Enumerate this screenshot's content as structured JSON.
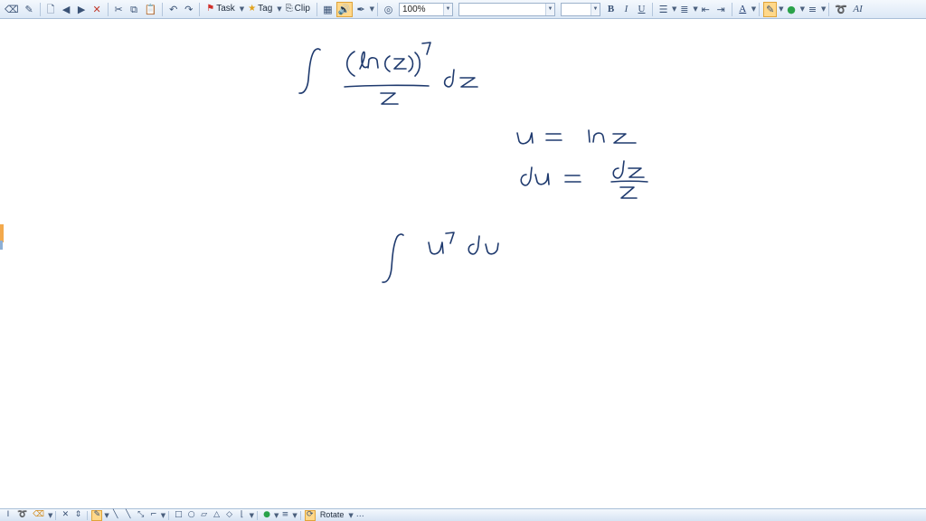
{
  "toolbar": {
    "task_label": "Task",
    "tag_label": "Tag",
    "clip_label": "Clip",
    "zoom_value": "100%",
    "font_name_value": "",
    "font_size_value": "",
    "bold_label": "B",
    "italic_label": "I",
    "underline_label": "U",
    "font_color_label": "A",
    "text_label": "A"
  },
  "bottom_toolbar": {
    "rotate_label": "Rotate"
  },
  "colors": {
    "ink": "#1f3a6e",
    "highlight": "#e0a43a",
    "font_color": "#1f3a6e",
    "fill_color": "#2aa24a"
  }
}
